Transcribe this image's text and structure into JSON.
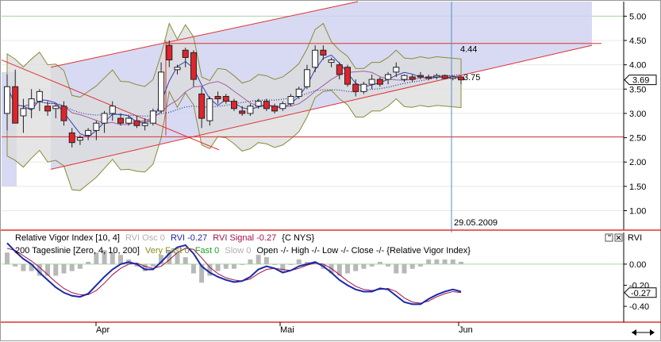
{
  "chart_data": [
    {
      "type": "candlestick",
      "title": "",
      "ylim": [
        0.6,
        5.3
      ],
      "yticks": [
        "5.00",
        "4.50",
        "4.00",
        "3.50",
        "3.00",
        "2.50",
        "2.00",
        "1.50",
        "1.00"
      ],
      "ytick_values": [
        5.0,
        4.5,
        4.0,
        3.5,
        3.0,
        2.5,
        2.0,
        1.5,
        1.0
      ],
      "last_price_label": "3.69",
      "last_price": 3.69,
      "horizontal_lines": [
        {
          "label": "4.44",
          "value": 4.44,
          "color": "#e03030"
        },
        {
          "label": "2.52",
          "value": 2.52,
          "color": "#e03030"
        }
      ],
      "level_labels": {
        "high": "4.44",
        "low": "3.75"
      },
      "low_label_value": 3.75,
      "cursor_date_label": "29.05.2009",
      "x_labels": [
        "Apr",
        "Mai",
        "Jun"
      ],
      "candles": [
        {
          "o": 3.0,
          "h": 3.8,
          "l": 2.65,
          "c": 3.55
        },
        {
          "o": 3.55,
          "h": 3.9,
          "l": 2.95,
          "c": 2.8
        },
        {
          "o": 2.95,
          "h": 3.3,
          "l": 2.6,
          "c": 3.1
        },
        {
          "o": 3.1,
          "h": 3.5,
          "l": 2.9,
          "c": 3.3
        },
        {
          "o": 3.25,
          "h": 3.5,
          "l": 3.05,
          "c": 3.45
        },
        {
          "o": 3.15,
          "h": 3.25,
          "l": 2.95,
          "c": 3.05
        },
        {
          "o": 3.1,
          "h": 3.2,
          "l": 2.9,
          "c": 3.15
        },
        {
          "o": 3.15,
          "h": 3.25,
          "l": 2.75,
          "c": 2.85
        },
        {
          "o": 2.6,
          "h": 2.7,
          "l": 2.3,
          "c": 2.4
        },
        {
          "o": 2.45,
          "h": 2.55,
          "l": 2.35,
          "c": 2.5
        },
        {
          "o": 2.55,
          "h": 2.7,
          "l": 2.45,
          "c": 2.65
        },
        {
          "o": 2.65,
          "h": 2.85,
          "l": 2.45,
          "c": 2.8
        },
        {
          "o": 2.8,
          "h": 3.05,
          "l": 2.6,
          "c": 3.0
        },
        {
          "o": 3.0,
          "h": 3.25,
          "l": 2.85,
          "c": 3.15
        },
        {
          "o": 2.9,
          "h": 3.0,
          "l": 2.75,
          "c": 2.8
        },
        {
          "o": 2.8,
          "h": 2.95,
          "l": 2.75,
          "c": 2.9
        },
        {
          "o": 2.85,
          "h": 2.95,
          "l": 2.7,
          "c": 2.75
        },
        {
          "o": 2.75,
          "h": 2.9,
          "l": 2.65,
          "c": 2.8
        },
        {
          "o": 2.8,
          "h": 3.1,
          "l": 2.75,
          "c": 3.05
        },
        {
          "o": 3.05,
          "h": 4.05,
          "l": 3.0,
          "c": 3.85
        },
        {
          "o": 4.4,
          "h": 4.5,
          "l": 3.95,
          "c": 4.1
        },
        {
          "o": 3.9,
          "h": 4.0,
          "l": 3.8,
          "c": 3.95
        },
        {
          "o": 4.3,
          "h": 4.35,
          "l": 3.95,
          "c": 4.15
        },
        {
          "o": 4.25,
          "h": 4.3,
          "l": 3.55,
          "c": 3.7
        },
        {
          "o": 3.4,
          "h": 3.55,
          "l": 2.7,
          "c": 2.9
        },
        {
          "o": 2.85,
          "h": 3.35,
          "l": 2.75,
          "c": 3.3
        },
        {
          "o": 3.35,
          "h": 3.45,
          "l": 3.2,
          "c": 3.3
        },
        {
          "o": 3.35,
          "h": 3.4,
          "l": 3.2,
          "c": 3.25
        },
        {
          "o": 3.25,
          "h": 3.3,
          "l": 3.05,
          "c": 3.1
        },
        {
          "o": 3.05,
          "h": 3.15,
          "l": 2.95,
          "c": 3.0
        },
        {
          "o": 3.0,
          "h": 3.2,
          "l": 2.95,
          "c": 3.15
        },
        {
          "o": 3.15,
          "h": 3.3,
          "l": 3.1,
          "c": 3.25
        },
        {
          "o": 3.25,
          "h": 3.3,
          "l": 3.05,
          "c": 3.1
        },
        {
          "o": 3.15,
          "h": 3.2,
          "l": 3.0,
          "c": 3.05
        },
        {
          "o": 3.1,
          "h": 3.25,
          "l": 3.05,
          "c": 3.2
        },
        {
          "o": 3.2,
          "h": 3.4,
          "l": 3.15,
          "c": 3.35
        },
        {
          "o": 3.35,
          "h": 3.55,
          "l": 3.3,
          "c": 3.5
        },
        {
          "o": 3.55,
          "h": 4.0,
          "l": 3.5,
          "c": 3.9
        },
        {
          "o": 3.95,
          "h": 4.4,
          "l": 3.85,
          "c": 4.3
        },
        {
          "o": 4.3,
          "h": 4.4,
          "l": 4.1,
          "c": 4.2
        },
        {
          "o": 4.05,
          "h": 4.15,
          "l": 3.95,
          "c": 4.1
        },
        {
          "o": 4.0,
          "h": 4.05,
          "l": 3.7,
          "c": 3.8
        },
        {
          "o": 3.95,
          "h": 4.0,
          "l": 3.55,
          "c": 3.6
        },
        {
          "o": 3.6,
          "h": 3.7,
          "l": 3.35,
          "c": 3.45
        },
        {
          "o": 3.45,
          "h": 3.65,
          "l": 3.4,
          "c": 3.6
        },
        {
          "o": 3.6,
          "h": 3.8,
          "l": 3.5,
          "c": 3.7
        },
        {
          "o": 3.7,
          "h": 3.75,
          "l": 3.55,
          "c": 3.6
        },
        {
          "o": 3.7,
          "h": 3.85,
          "l": 3.6,
          "c": 3.8
        },
        {
          "o": 3.85,
          "h": 4.05,
          "l": 3.75,
          "c": 3.95
        },
        {
          "o": 3.7,
          "h": 3.8,
          "l": 3.65,
          "c": 3.78
        },
        {
          "o": 3.75,
          "h": 3.8,
          "l": 3.65,
          "c": 3.7
        },
        {
          "o": 3.78,
          "h": 3.85,
          "l": 3.7,
          "c": 3.75
        },
        {
          "o": 3.75,
          "h": 3.8,
          "l": 3.68,
          "c": 3.72
        },
        {
          "o": 3.75,
          "h": 3.82,
          "l": 3.7,
          "c": 3.78
        },
        {
          "o": 3.78,
          "h": 3.8,
          "l": 3.7,
          "c": 3.72
        },
        {
          "o": 3.72,
          "h": 3.78,
          "l": 3.68,
          "c": 3.75
        },
        {
          "o": 3.75,
          "h": 3.78,
          "l": 3.6,
          "c": 3.69
        }
      ]
    },
    {
      "type": "line",
      "title": "",
      "ylim": [
        -0.55,
        0.3
      ],
      "yticks": [
        "0.00",
        "-0.20",
        "-0.40"
      ],
      "ytick_values": [
        0.0,
        -0.2,
        -0.4
      ],
      "last_value_label": "-0.27",
      "series": [
        {
          "name": "RVI",
          "color": "#1a2aa8",
          "values": [
            0.2,
            0.12,
            0.05,
            0.0,
            -0.08,
            -0.15,
            -0.22,
            -0.27,
            -0.3,
            -0.31,
            -0.28,
            -0.2,
            -0.12,
            -0.05,
            0.0,
            0.02,
            0.0,
            -0.05,
            -0.05,
            0.02,
            0.1,
            0.16,
            0.18,
            0.1,
            -0.02,
            -0.08,
            -0.12,
            -0.15,
            -0.17,
            -0.16,
            -0.12,
            -0.05,
            -0.02,
            -0.04,
            -0.08,
            -0.06,
            -0.02,
            0.0,
            0.02,
            -0.02,
            -0.08,
            -0.15,
            -0.2,
            -0.24,
            -0.26,
            -0.26,
            -0.23,
            -0.24,
            -0.3,
            -0.36,
            -0.38,
            -0.38,
            -0.33,
            -0.29,
            -0.26,
            -0.24,
            -0.26
          ]
        },
        {
          "name": "RVI Signal",
          "color": "#a0104a",
          "values": [
            0.15,
            0.13,
            0.08,
            0.03,
            -0.03,
            -0.1,
            -0.17,
            -0.23,
            -0.27,
            -0.29,
            -0.29,
            -0.25,
            -0.18,
            -0.1,
            -0.04,
            0.0,
            0.01,
            -0.02,
            -0.04,
            -0.02,
            0.04,
            0.11,
            0.15,
            0.14,
            0.06,
            -0.03,
            -0.09,
            -0.13,
            -0.15,
            -0.16,
            -0.14,
            -0.09,
            -0.05,
            -0.04,
            -0.05,
            -0.06,
            -0.04,
            -0.01,
            0.01,
            0.0,
            -0.04,
            -0.1,
            -0.16,
            -0.21,
            -0.24,
            -0.25,
            -0.24,
            -0.23,
            -0.26,
            -0.32,
            -0.36,
            -0.37,
            -0.35,
            -0.31,
            -0.28,
            -0.26,
            -0.27
          ]
        },
        {
          "name": "RVI Osc",
          "color": "#b8b8b8",
          "values": [
            0.05,
            -0.01,
            -0.03,
            -0.03,
            -0.05,
            -0.05,
            -0.05,
            -0.04,
            -0.03,
            -0.02,
            0.01,
            0.05,
            0.06,
            0.05,
            0.04,
            0.02,
            -0.01,
            -0.03,
            -0.01,
            0.04,
            0.06,
            0.05,
            0.03,
            -0.04,
            -0.08,
            -0.05,
            -0.03,
            -0.02,
            -0.02,
            0.0,
            0.02,
            0.04,
            0.03,
            0.0,
            -0.03,
            0.0,
            0.02,
            0.01,
            0.01,
            -0.02,
            -0.04,
            -0.05,
            -0.04,
            -0.03,
            -0.02,
            -0.01,
            0.01,
            -0.01,
            -0.04,
            -0.04,
            -0.02,
            -0.01,
            0.02,
            0.02,
            0.02,
            0.02,
            0.01
          ]
        }
      ]
    }
  ],
  "indicator_header": {
    "line1": {
      "name": "Relative Vigor Index [10, 4]",
      "osc": "RVI Osc 0",
      "rvi": "RVI -0.27",
      "signal": "RVI Signal -0.27",
      "symbol": "{C NYS}"
    },
    "line2": {
      "name": "200 Tageslinie [Zero, 4, 10, 200]",
      "very_fast": "Very Fast 0",
      "fast": "Fast 0",
      "slow": "Slow 0",
      "ohlc": "Open -/- High -/- Low -/- Close -/- {Relative Vigor Index}"
    },
    "panel_tag": "RVI"
  },
  "colors": {
    "up_candle": "#ffffff",
    "down_candle": "#e0242c",
    "bollinger_fill": "#dcdcdc",
    "bollinger_line": "#8a8a3a",
    "channel_fill": "#d0d3f0",
    "trend_line": "#e03030",
    "ma_fast": "#3040c0",
    "ma_mid": "#a060a0",
    "ma_slow": "#2030a0"
  }
}
